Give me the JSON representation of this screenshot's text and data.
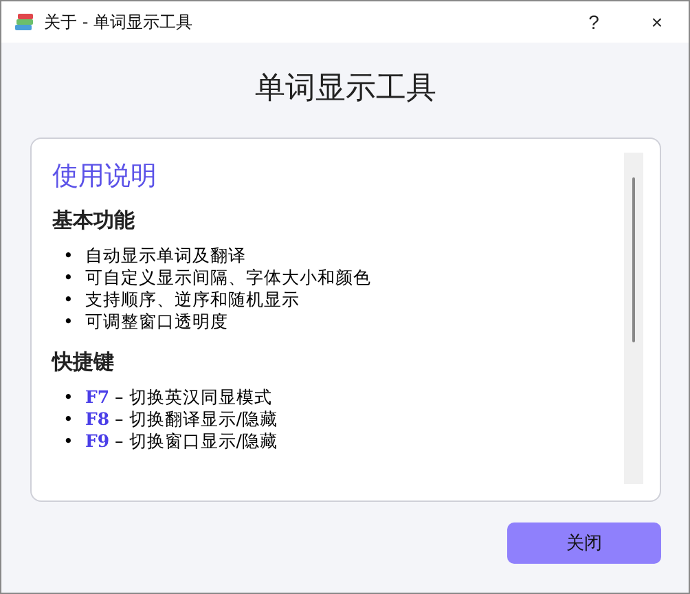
{
  "window": {
    "title": "关于 - 单词显示工具",
    "buttons": [
      "?",
      "×"
    ]
  },
  "heading": "单词显示工具",
  "content": {
    "title": "使用说明",
    "sections": [
      {
        "heading": "基本功能",
        "kind": "plain",
        "bullet": "•",
        "items": [
          {
            "text": "自动显示单词及翻译"
          },
          {
            "text": "可自定义显示间隔、字体大小和颜色"
          },
          {
            "text": "支持顺序、逆序和随机显示"
          },
          {
            "text": "可调整窗口透明度"
          }
        ]
      },
      {
        "heading": "快捷键",
        "kind": "shortcut",
        "bullet": "•",
        "items": [
          {
            "key": "F7",
            "text": "– 切换英汉同显模式"
          },
          {
            "key": "F8",
            "text": "– 切换翻译显示/隐藏"
          },
          {
            "key": "F9",
            "text": "– 切换窗口显示/隐藏"
          }
        ]
      }
    ]
  },
  "close_button": "关闭"
}
